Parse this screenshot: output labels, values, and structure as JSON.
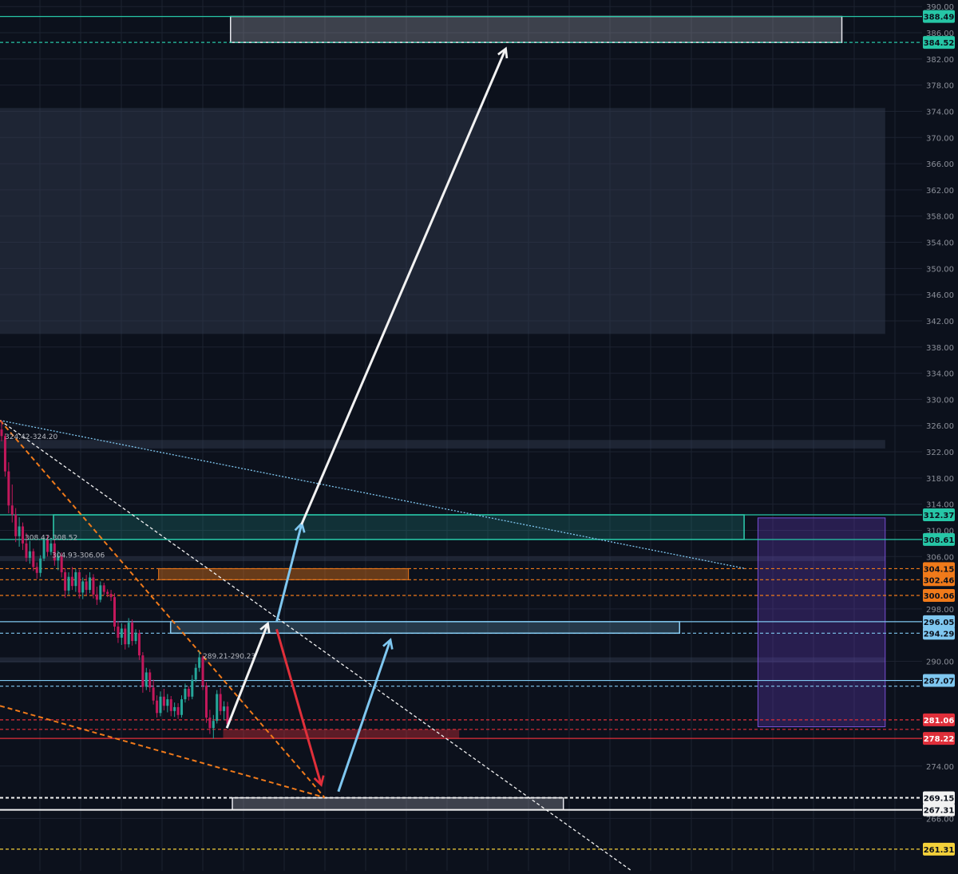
{
  "chart_data": {
    "type": "candlestick",
    "title": "",
    "xlabel": "",
    "ylabel": "",
    "ylim": [
      258,
      391
    ],
    "grid": true,
    "y_ticks": [
      390.0,
      386.0,
      382.0,
      378.0,
      374.0,
      370.0,
      366.0,
      362.0,
      358.0,
      354.0,
      350.0,
      346.0,
      342.0,
      338.0,
      334.0,
      330.0,
      326.0,
      322.0,
      318.0,
      314.0,
      310.0,
      306.0,
      298.0,
      290.0,
      274.0,
      266.0
    ],
    "colors": {
      "teal": "#26c6a6",
      "light_blue": "#7fc7f0",
      "orange": "#f07a1a",
      "red": "#e02f3a",
      "white": "#f2f2f2",
      "yellow": "#f3d03a",
      "purple": "#6a3fc8",
      "bull_candle": "#26a69a",
      "bear_candle": "#c2185b",
      "grid": "#1c2230"
    },
    "price_levels": [
      {
        "price": 388.49,
        "label": "388.49",
        "color": "teal",
        "style": "solid"
      },
      {
        "price": 384.52,
        "label": "384.52",
        "color": "teal",
        "style": "dashed"
      },
      {
        "price": 312.37,
        "label": "312.37",
        "color": "teal",
        "style": "solid"
      },
      {
        "price": 308.61,
        "label": "308.61",
        "color": "teal",
        "style": "solid"
      },
      {
        "price": 304.15,
        "label": "304.15",
        "color": "orange",
        "style": "dashed"
      },
      {
        "price": 302.46,
        "label": "302.46",
        "color": "orange",
        "style": "dashed"
      },
      {
        "price": 300.06,
        "label": "300.06",
        "color": "orange",
        "style": "dashed"
      },
      {
        "price": 296.05,
        "label": "296.05",
        "color": "light_blue",
        "style": "solid"
      },
      {
        "price": 294.29,
        "label": "294.29",
        "color": "light_blue",
        "style": "dashed"
      },
      {
        "price": 287.07,
        "label": "287.07",
        "color": "light_blue",
        "style": "solid"
      },
      {
        "price": 286.2,
        "label": "",
        "color": "light_blue",
        "style": "dashed"
      },
      {
        "price": 281.06,
        "label": "281.06",
        "color": "red",
        "style": "dashed"
      },
      {
        "price": 279.6,
        "label": "",
        "color": "red",
        "style": "dashed"
      },
      {
        "price": 278.22,
        "label": "278.22",
        "color": "red",
        "style": "solid"
      },
      {
        "price": 269.15,
        "label": "269.15",
        "color": "white",
        "style": "dashed"
      },
      {
        "price": 267.31,
        "label": "267.31",
        "color": "white",
        "style": "solid"
      },
      {
        "price": 261.31,
        "label": "261.31",
        "color": "yellow",
        "style": "dashed"
      }
    ],
    "zones": [
      {
        "name": "upper-target-zone",
        "y_low": 384.52,
        "y_high": 388.49,
        "x_start": 0.25,
        "x_end": 0.913,
        "color": "white"
      },
      {
        "name": "wide-gray-band",
        "y_low": 340.0,
        "y_high": 374.5,
        "x_start": 0.0,
        "x_end": 0.96,
        "color": "gray"
      },
      {
        "name": "top-thin-band",
        "y_low": 322.5,
        "y_high": 323.8,
        "x_start": 0.0,
        "x_end": 0.96,
        "color": "gray"
      },
      {
        "name": "teal-zone",
        "y_low": 308.61,
        "y_high": 312.37,
        "x_start": 0.058,
        "x_end": 0.807,
        "color": "teal"
      },
      {
        "name": "thin-band-306",
        "y_low": 305.3,
        "y_high": 306.0,
        "x_start": 0.0,
        "x_end": 0.96,
        "color": "gray"
      },
      {
        "name": "orange-zone",
        "y_low": 302.46,
        "y_high": 304.15,
        "x_start": 0.172,
        "x_end": 0.443,
        "color": "orange"
      },
      {
        "name": "light-blue-zone",
        "y_low": 294.29,
        "y_high": 296.05,
        "x_start": 0.185,
        "x_end": 0.737,
        "color": "light_blue"
      },
      {
        "name": "thin-band-290",
        "y_low": 289.8,
        "y_high": 290.6,
        "x_start": 0.0,
        "x_end": 0.96,
        "color": "gray"
      },
      {
        "name": "red-zone",
        "y_low": 278.22,
        "y_high": 279.6,
        "x_start": 0.242,
        "x_end": 0.498,
        "color": "red"
      },
      {
        "name": "white-bottom-zone",
        "y_low": 267.31,
        "y_high": 269.15,
        "x_start": 0.252,
        "x_end": 0.611,
        "color": "white"
      },
      {
        "name": "purple-projection",
        "y_low": 280.0,
        "y_high": 311.9,
        "x_start": 0.822,
        "x_end": 0.96,
        "color": "purple"
      }
    ],
    "range_labels": [
      {
        "text": "324.42-324.20",
        "price": 324.3
      },
      {
        "text": "308.42-308.52",
        "price": 308.9
      },
      {
        "text": "304.93-306.06",
        "price": 306.2
      },
      {
        "text": "289.21-290.23",
        "price": 290.8
      }
    ],
    "trendlines": [
      {
        "name": "light-blue-dotted-trendline",
        "from": {
          "x": 0.0,
          "price": 326.8
        },
        "to": {
          "x": 0.807,
          "price": 304.2
        },
        "color": "light_blue",
        "style": "dotted"
      },
      {
        "name": "white-dashed-trendline",
        "from": {
          "x": 0.0,
          "price": 326.8
        },
        "to": {
          "x": 0.685,
          "price": 258.0
        },
        "color": "white",
        "style": "dashed"
      },
      {
        "name": "orange-dashed-trendline-steep",
        "from": {
          "x": 0.0,
          "price": 326.8
        },
        "to": {
          "x": 0.352,
          "price": 269.2
        },
        "color": "orange",
        "style": "dashed"
      },
      {
        "name": "orange-dashed-trendline-shallow",
        "from": {
          "x": 0.0,
          "price": 283.2
        },
        "to": {
          "x": 0.352,
          "price": 269.2
        },
        "color": "orange",
        "style": "dashed"
      }
    ],
    "arrows": [
      {
        "name": "white-arrow-small",
        "from": {
          "x": 0.246,
          "price": 279.8
        },
        "to": {
          "x": 0.29,
          "price": 295.6
        },
        "color": "white"
      },
      {
        "name": "blue-arrow-upper",
        "from": {
          "x": 0.3,
          "price": 296.0
        },
        "to": {
          "x": 0.327,
          "price": 310.9
        },
        "color": "light_blue"
      },
      {
        "name": "white-arrow-large",
        "from": {
          "x": 0.327,
          "price": 310.9
        },
        "to": {
          "x": 0.548,
          "price": 383.4
        },
        "color": "white"
      },
      {
        "name": "red-arrow-down",
        "from": {
          "x": 0.3,
          "price": 294.9
        },
        "to": {
          "x": 0.348,
          "price": 271.3
        },
        "color": "red"
      },
      {
        "name": "blue-arrow-lower",
        "from": {
          "x": 0.367,
          "price": 270.1
        },
        "to": {
          "x": 0.423,
          "price": 293.1
        },
        "color": "light_blue"
      }
    ],
    "candles": [
      {
        "o": 325.4,
        "h": 326.8,
        "l": 323.6,
        "c": 324.4
      },
      {
        "o": 324.4,
        "h": 324.8,
        "l": 318.2,
        "c": 319.0
      },
      {
        "o": 319.0,
        "h": 320.4,
        "l": 312.6,
        "c": 313.8
      },
      {
        "o": 313.8,
        "h": 317.0,
        "l": 311.2,
        "c": 312.4
      },
      {
        "o": 312.4,
        "h": 313.4,
        "l": 308.2,
        "c": 309.1
      },
      {
        "o": 309.1,
        "h": 312.0,
        "l": 307.5,
        "c": 310.6
      },
      {
        "o": 310.6,
        "h": 311.2,
        "l": 307.0,
        "c": 308.0
      },
      {
        "o": 308.0,
        "h": 309.6,
        "l": 305.2,
        "c": 305.8
      },
      {
        "o": 305.8,
        "h": 308.4,
        "l": 304.9,
        "c": 306.8
      },
      {
        "o": 306.8,
        "h": 307.2,
        "l": 303.8,
        "c": 304.4
      },
      {
        "o": 304.4,
        "h": 305.1,
        "l": 302.6,
        "c": 303.5
      },
      {
        "o": 303.5,
        "h": 306.2,
        "l": 302.9,
        "c": 305.7
      },
      {
        "o": 305.7,
        "h": 309.0,
        "l": 305.3,
        "c": 308.5
      },
      {
        "o": 308.5,
        "h": 309.2,
        "l": 306.0,
        "c": 306.7
      },
      {
        "o": 306.7,
        "h": 308.8,
        "l": 306.2,
        "c": 308.0
      },
      {
        "o": 308.0,
        "h": 308.6,
        "l": 304.6,
        "c": 305.4
      },
      {
        "o": 305.4,
        "h": 306.9,
        "l": 303.9,
        "c": 306.1
      },
      {
        "o": 306.1,
        "h": 306.6,
        "l": 302.8,
        "c": 303.6
      },
      {
        "o": 303.6,
        "h": 304.2,
        "l": 299.7,
        "c": 300.8
      },
      {
        "o": 300.8,
        "h": 303.6,
        "l": 300.2,
        "c": 302.9
      },
      {
        "o": 302.9,
        "h": 304.4,
        "l": 300.9,
        "c": 301.5
      },
      {
        "o": 301.5,
        "h": 304.1,
        "l": 300.6,
        "c": 303.6
      },
      {
        "o": 303.6,
        "h": 304.0,
        "l": 299.6,
        "c": 300.5
      },
      {
        "o": 300.5,
        "h": 302.8,
        "l": 299.5,
        "c": 302.2
      },
      {
        "o": 302.2,
        "h": 303.2,
        "l": 300.1,
        "c": 300.9
      },
      {
        "o": 300.9,
        "h": 303.6,
        "l": 300.4,
        "c": 302.8
      },
      {
        "o": 302.8,
        "h": 303.3,
        "l": 299.6,
        "c": 300.2
      },
      {
        "o": 300.2,
        "h": 301.4,
        "l": 298.6,
        "c": 299.4
      },
      {
        "o": 299.4,
        "h": 302.2,
        "l": 299.0,
        "c": 301.6
      },
      {
        "o": 301.6,
        "h": 302.0,
        "l": 300.1,
        "c": 300.6
      },
      {
        "o": 300.6,
        "h": 301.0,
        "l": 299.8,
        "c": 300.3
      },
      {
        "o": 300.3,
        "h": 300.9,
        "l": 299.2,
        "c": 299.8
      },
      {
        "o": 299.8,
        "h": 300.4,
        "l": 294.6,
        "c": 295.3
      },
      {
        "o": 295.3,
        "h": 296.1,
        "l": 292.8,
        "c": 293.6
      },
      {
        "o": 293.6,
        "h": 295.8,
        "l": 292.5,
        "c": 295.0
      },
      {
        "o": 295.0,
        "h": 295.6,
        "l": 291.8,
        "c": 292.6
      },
      {
        "o": 292.6,
        "h": 296.6,
        "l": 292.1,
        "c": 295.9
      },
      {
        "o": 295.9,
        "h": 296.4,
        "l": 292.4,
        "c": 293.1
      },
      {
        "o": 293.1,
        "h": 294.9,
        "l": 292.6,
        "c": 294.3
      },
      {
        "o": 294.3,
        "h": 294.8,
        "l": 290.2,
        "c": 290.9
      },
      {
        "o": 290.9,
        "h": 291.4,
        "l": 285.2,
        "c": 286.1
      },
      {
        "o": 286.1,
        "h": 289.0,
        "l": 285.6,
        "c": 288.3
      },
      {
        "o": 288.3,
        "h": 288.8,
        "l": 285.3,
        "c": 286.0
      },
      {
        "o": 286.0,
        "h": 287.2,
        "l": 283.4,
        "c": 284.0
      },
      {
        "o": 284.0,
        "h": 284.8,
        "l": 281.4,
        "c": 282.1
      },
      {
        "o": 282.1,
        "h": 285.4,
        "l": 281.6,
        "c": 284.6
      },
      {
        "o": 284.6,
        "h": 285.8,
        "l": 282.5,
        "c": 283.2
      },
      {
        "o": 283.2,
        "h": 285.0,
        "l": 282.2,
        "c": 284.2
      },
      {
        "o": 284.2,
        "h": 284.7,
        "l": 281.6,
        "c": 282.4
      },
      {
        "o": 282.4,
        "h": 283.7,
        "l": 281.5,
        "c": 283.0
      },
      {
        "o": 283.0,
        "h": 283.6,
        "l": 281.2,
        "c": 281.8
      },
      {
        "o": 281.8,
        "h": 284.8,
        "l": 281.4,
        "c": 284.2
      },
      {
        "o": 284.2,
        "h": 286.6,
        "l": 283.7,
        "c": 285.8
      },
      {
        "o": 285.8,
        "h": 286.2,
        "l": 284.0,
        "c": 284.6
      },
      {
        "o": 284.6,
        "h": 287.9,
        "l": 284.2,
        "c": 287.2
      },
      {
        "o": 287.2,
        "h": 289.6,
        "l": 286.8,
        "c": 289.0
      },
      {
        "o": 289.0,
        "h": 291.5,
        "l": 288.4,
        "c": 290.6
      },
      {
        "o": 290.6,
        "h": 290.9,
        "l": 285.6,
        "c": 286.3
      },
      {
        "o": 286.3,
        "h": 286.8,
        "l": 280.6,
        "c": 281.4
      },
      {
        "o": 281.4,
        "h": 282.6,
        "l": 278.9,
        "c": 279.8
      },
      {
        "o": 279.8,
        "h": 281.8,
        "l": 278.2,
        "c": 280.9
      },
      {
        "o": 280.9,
        "h": 285.6,
        "l": 280.5,
        "c": 285.0
      },
      {
        "o": 285.0,
        "h": 285.9,
        "l": 281.8,
        "c": 282.4
      },
      {
        "o": 282.4,
        "h": 283.9,
        "l": 281.0,
        "c": 283.1
      },
      {
        "o": 283.1,
        "h": 283.8,
        "l": 279.8,
        "c": 280.4
      }
    ]
  }
}
